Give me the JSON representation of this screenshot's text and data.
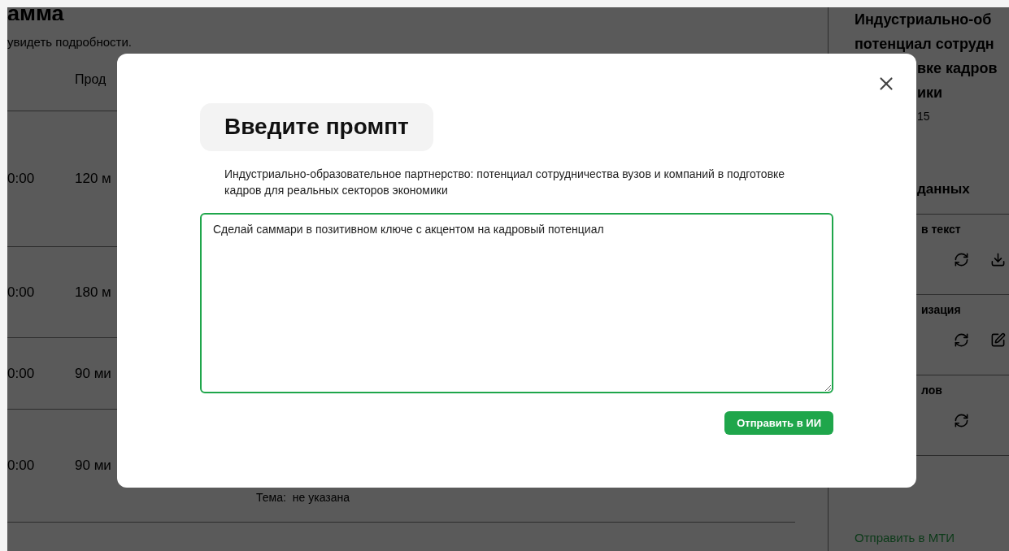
{
  "page": {
    "title": "амма",
    "subtitle": "увидеть подробности.",
    "table": {
      "columns": [
        "Прод"
      ],
      "rows": [
        {
          "time": "0:00",
          "duration": "120 м"
        },
        {
          "time": "0:00",
          "duration": "180 м"
        },
        {
          "time": "0:00",
          "duration": "90 ми"
        },
        {
          "time": "0:00",
          "duration": "90 ми",
          "topic_label": "Тема:",
          "topic": "не указана"
        }
      ]
    }
  },
  "side_panel": {
    "title_lines": [
      "Индустриально-об",
      "потенциал сотрудн",
      "вке кадров",
      "ики"
    ],
    "date": "15",
    "section_title": "данных",
    "items": [
      {
        "label": "в текст",
        "actions": [
          {
            "kind": "refresh"
          },
          {
            "kind": "download"
          }
        ]
      },
      {
        "label": "изация",
        "actions": [
          {
            "kind": "refresh"
          },
          {
            "kind": "edit"
          }
        ]
      },
      {
        "label": "лов",
        "actions": [
          {
            "kind": "refresh"
          }
        ]
      }
    ],
    "link": "Отправить в МТИ"
  },
  "modal": {
    "title": "Введите промпт",
    "description": "Индустриально-образовательное партнерство: потенциал сотрудничества вузов и компаний в подготовке кадров для реальных секторов экономики",
    "prompt": "Сделай саммари в позитивном ключе с акцентом на кадровый потенциал",
    "submit": "Отправить в ИИ"
  }
}
